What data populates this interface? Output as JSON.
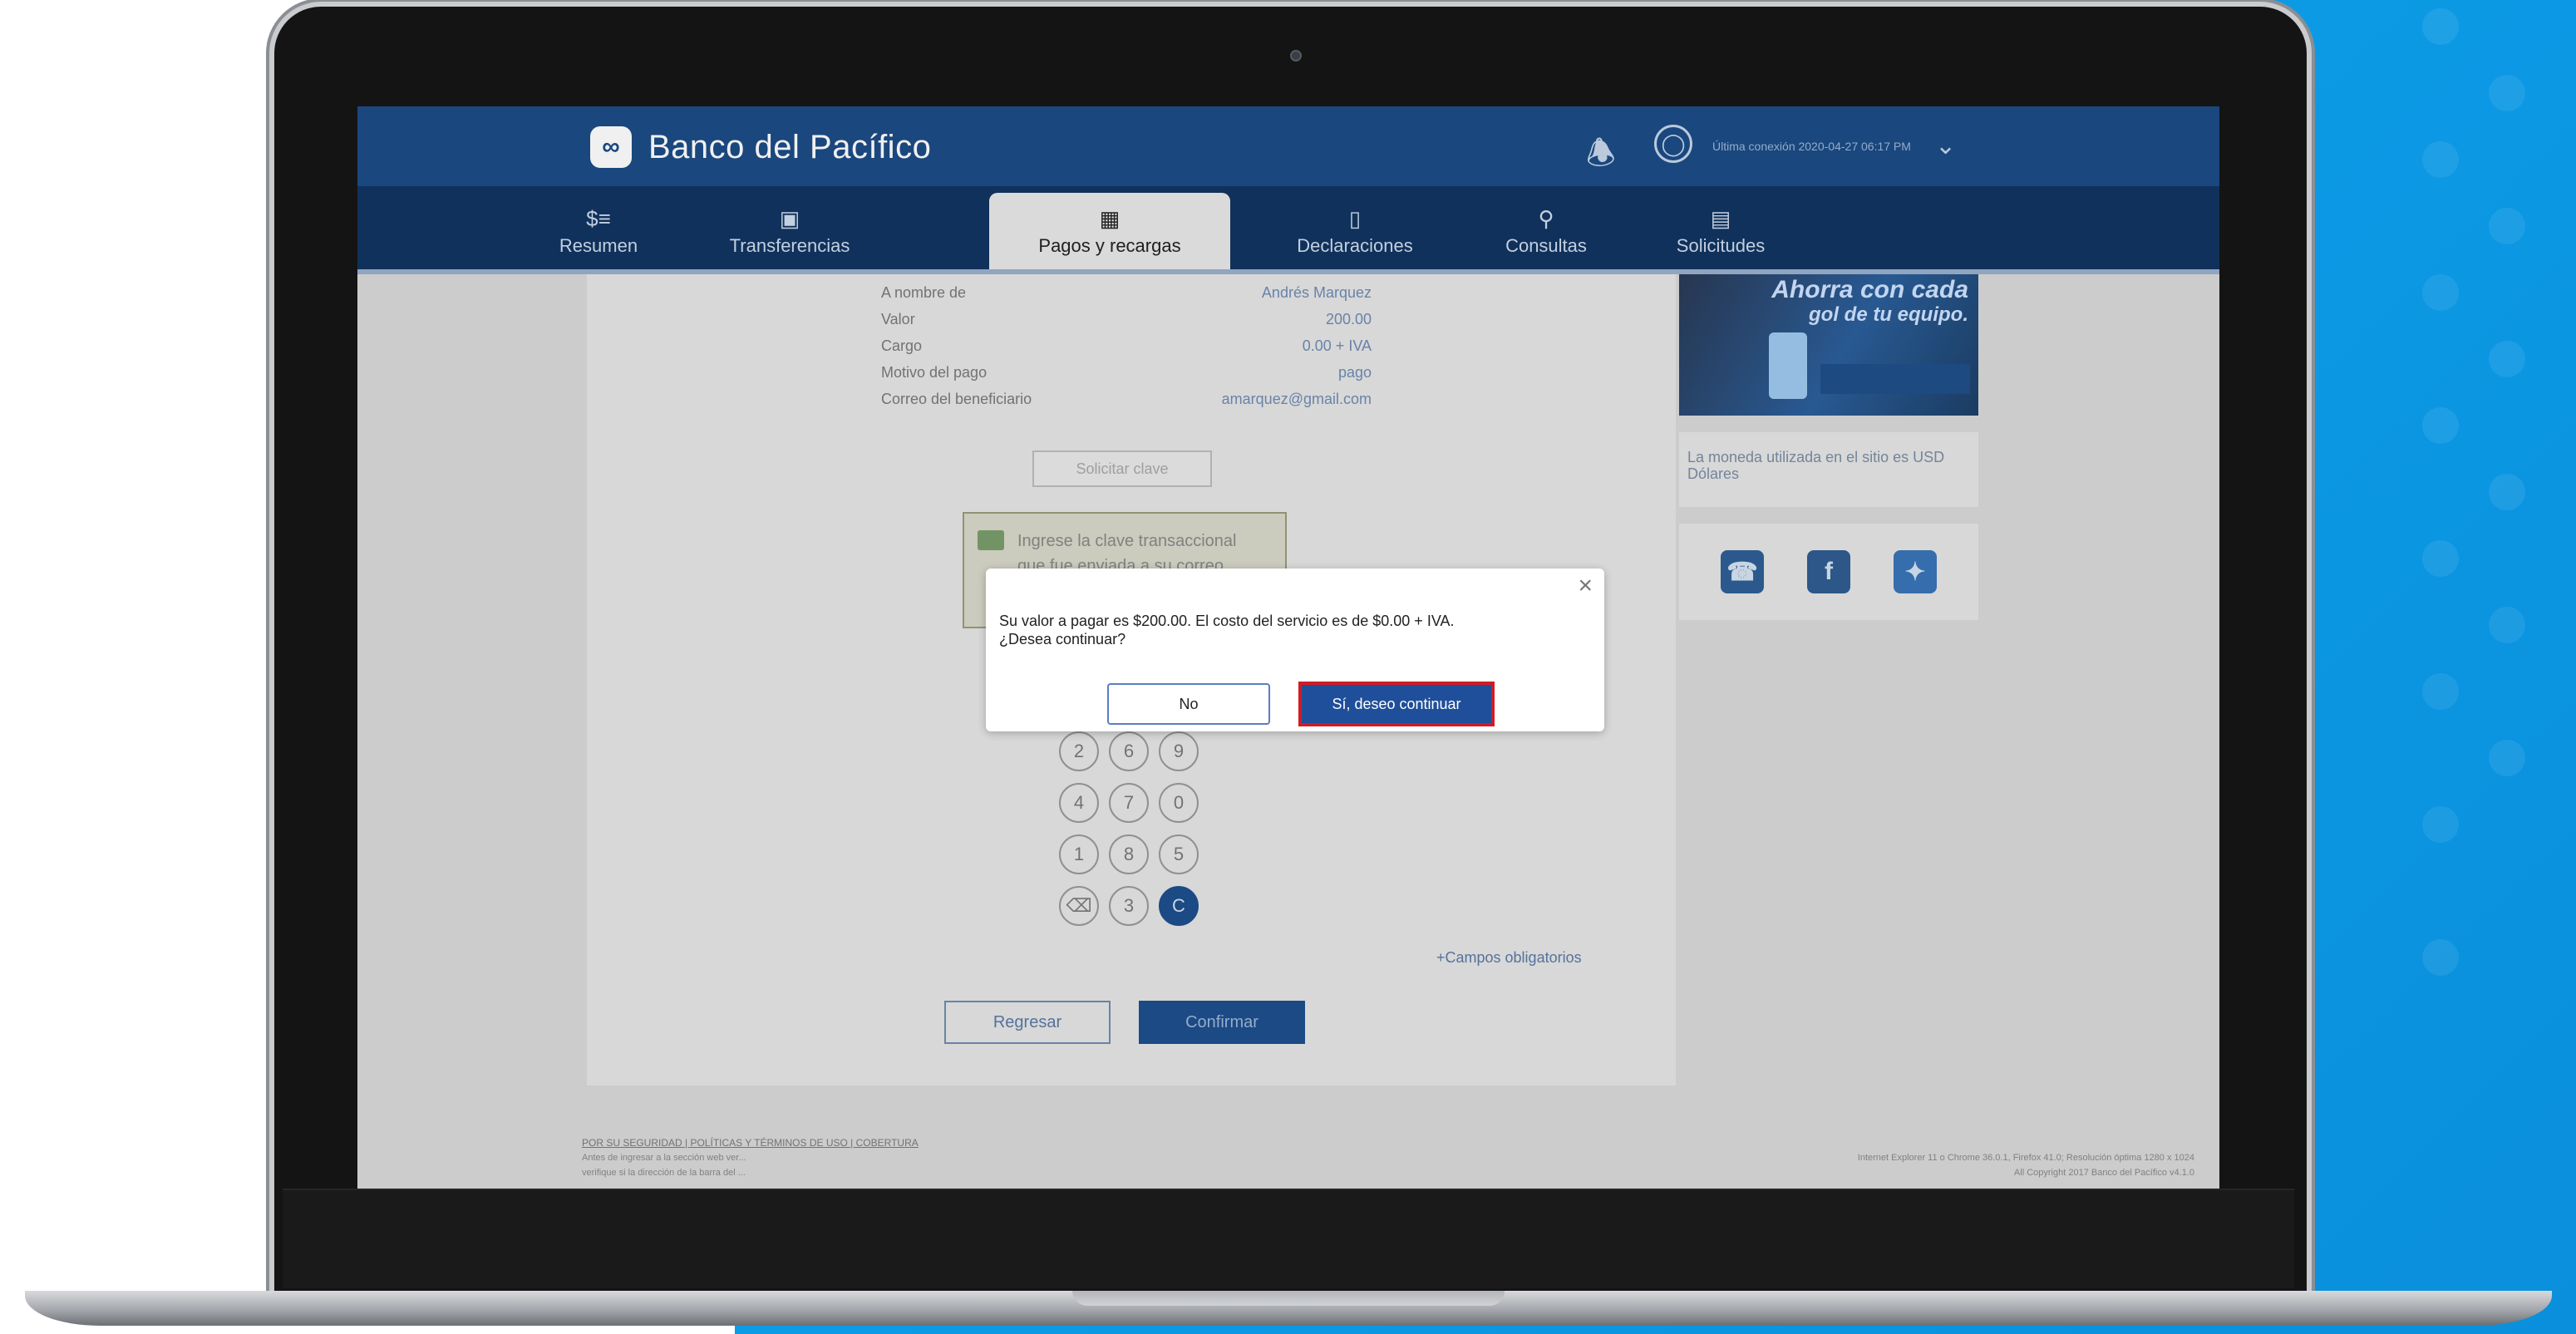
{
  "brand": {
    "name": "Banco del Pacífico",
    "logo_icon": "bank-logo-icon",
    "primary_color": "#1c4c86",
    "accent_color": "#1f4f9a",
    "highlight_color": "#d01c24"
  },
  "header": {
    "last_login": "Última conexión 2020-04-27 06:17 PM",
    "bell_icon": "bell-icon",
    "user_icon": "user-icon"
  },
  "nav": {
    "items": [
      {
        "label": "Resumen",
        "icon": "dollar-list-icon"
      },
      {
        "label": "Transferencias",
        "icon": "transfer-icon"
      },
      {
        "label": "Pagos y recargas",
        "icon": "wallet-icon",
        "active": true
      },
      {
        "label": "Declaraciones",
        "icon": "document-icon"
      },
      {
        "label": "Consultas",
        "icon": "search-icon"
      },
      {
        "label": "Solicitudes",
        "icon": "form-icon"
      }
    ]
  },
  "details": [
    {
      "label": "A nombre de",
      "value": "Andrés Marquez"
    },
    {
      "label": "Valor",
      "value": "200.00"
    },
    {
      "label": "Cargo",
      "value": "0.00 + IVA"
    },
    {
      "label": "Motivo del pago",
      "value": "pago"
    },
    {
      "label": "Correo del beneficiario",
      "value": "amarquez@gmail.com"
    }
  ],
  "request_key_button": "Solicitar clave",
  "info_message": "Ingrese la clave transaccional que fue enviada a su correo",
  "keypad": {
    "rows": [
      [
        "2",
        "6",
        "9"
      ],
      [
        "4",
        "7",
        "0"
      ],
      [
        "1",
        "8",
        "5"
      ],
      [
        "⌫",
        "3",
        "C"
      ]
    ]
  },
  "required_note": "+Campos obligatorios",
  "actions": {
    "back": "Regresar",
    "confirm": "Confirmar"
  },
  "sidebar": {
    "promo_text_1": "Ahorra con cada",
    "promo_text_2": "gol de tu equipo.",
    "currency_note": "La moneda utilizada en el sitio es USD Dólares",
    "social": [
      "headset-icon",
      "facebook-icon",
      "twitter-icon"
    ]
  },
  "footer": {
    "links": "POR SU SEGURIDAD | POLÍTICAS Y TÉRMINOS DE USO | COBERTURA",
    "line_1": "Antes de ingresar a la sección web ver...",
    "line_2": "verifique si la dirección de la barra del ...",
    "right_line_1": "Internet Explorer 11 o Chrome 36.0.1, Firefox 41.0; Resolución óptima 1280 x 1024",
    "right_line_2": "All Copyright 2017 Banco del Pacífico v4.1.0"
  },
  "dialog": {
    "close_icon": "close-icon",
    "message_line_1": "Su valor a pagar es $200.00. El costo del servicio es de $0.00 + IVA.",
    "message_line_2": "¿Desea continuar?",
    "no_label": "No",
    "yes_label": "Sí, deseo continuar"
  }
}
